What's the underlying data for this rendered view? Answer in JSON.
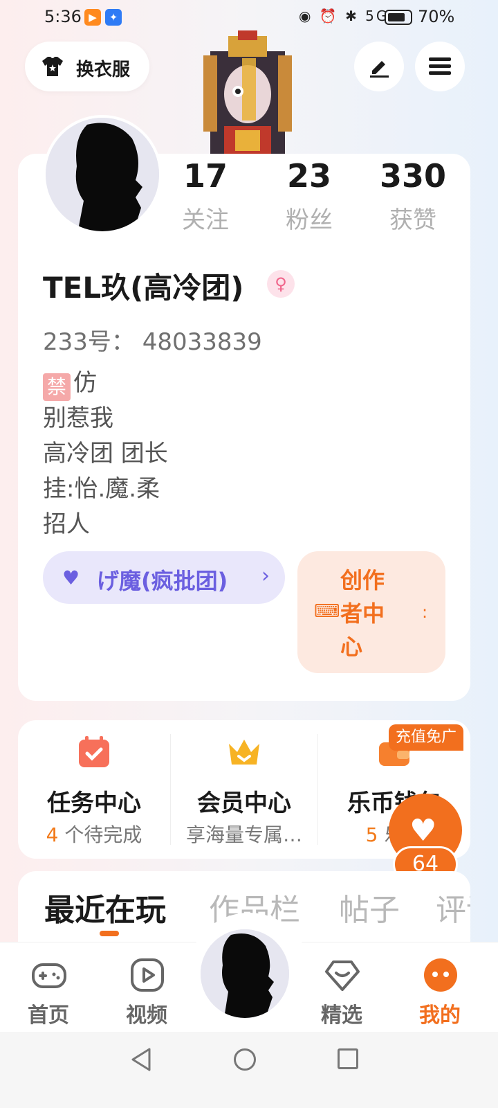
{
  "status_bar": {
    "time": "5:36",
    "icons": "◉ ⏰ ✱ 5G",
    "battery": "70%"
  },
  "top_bar": {
    "outfit_label": "换衣服"
  },
  "profile": {
    "stats": [
      {
        "value": "17",
        "label": "关注"
      },
      {
        "value": "23",
        "label": "粉丝"
      },
      {
        "value": "330",
        "label": "获赞"
      }
    ],
    "username": "TEL玖(高冷团)",
    "gender_symbol": "♀",
    "user_id": "233号：  48033839",
    "bio_mark": "禁",
    "bio_lines": [
      "仿",
      "别惹我",
      "高冷团 团长",
      "挂:怡.魔.柔",
      "招人"
    ],
    "group_name": "げ魔(疯批团)",
    "group_chevron": "›",
    "creator_label": "创作者中心"
  },
  "services": {
    "promo_tag": "充值免广",
    "items": [
      {
        "title": "任务中心",
        "accent": "4",
        "sub": " 个待完成"
      },
      {
        "title": "会员中心",
        "accent": "",
        "sub": "享海量专属…"
      },
      {
        "title": "乐币钱包",
        "accent": "5",
        "sub": " 乐币"
      }
    ]
  },
  "like_float": {
    "count": "64"
  },
  "tabs": [
    "最近在玩",
    "作品栏",
    "帖子",
    "评论"
  ],
  "bottom_nav": [
    {
      "label": "首页",
      "icon": "gamepad-icon"
    },
    {
      "label": "视频",
      "icon": "video-icon"
    },
    {
      "label": "精选",
      "icon": "heart-gem-icon"
    },
    {
      "label": "我的",
      "icon": "face-icon"
    }
  ],
  "colors": {
    "accent": "#f26f1e",
    "group": "#6b5fe0"
  }
}
